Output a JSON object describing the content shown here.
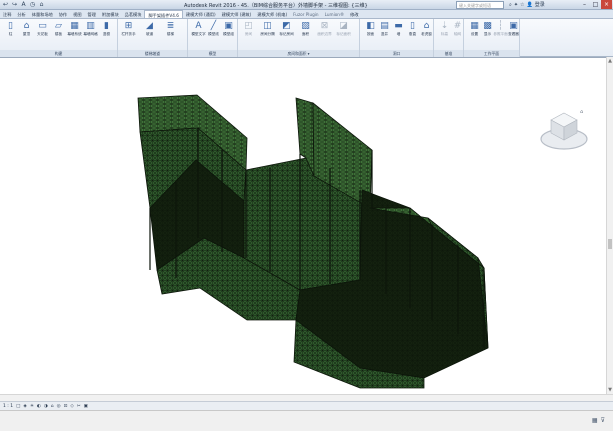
{
  "window": {
    "title": "Autodesk Revit 2016 -     45.（BIM综合服务平台）外墙脚手架 - 三维视图: {三维}",
    "search_placeholder": "键入关键字或短语",
    "login": "登录",
    "quick_access": [
      "↩",
      "↪",
      "A",
      "◷",
      "⌂"
    ]
  },
  "tabs": [
    {
      "label": "注释",
      "active": false
    },
    {
      "label": "分析",
      "active": false
    },
    {
      "label": "体量和场地",
      "active": false
    },
    {
      "label": "协作",
      "active": false
    },
    {
      "label": "视图",
      "active": false
    },
    {
      "label": "管理",
      "active": false
    },
    {
      "label": "附加模块",
      "active": false
    },
    {
      "label": "品茗模块",
      "active": false
    },
    {
      "label": "脚手架插件V4.6",
      "active": true
    },
    {
      "label": "建模大师 (通用)",
      "active": false
    },
    {
      "label": "建模大师 (建筑)",
      "active": false
    },
    {
      "label": "建模大师 (机电)",
      "active": false
    },
    {
      "label": "Fuzor Plugin",
      "active": false
    },
    {
      "label": "Lumion®",
      "active": false
    },
    {
      "label": "修改",
      "active": false
    }
  ],
  "ribbon": {
    "panels": [
      {
        "title": "构建",
        "tools": [
          {
            "label": "柱",
            "icon": "column-icon",
            "glyph": "▯",
            "dim": false
          },
          {
            "label": "屋顶",
            "icon": "roof-icon",
            "glyph": "⌂",
            "dim": false
          },
          {
            "label": "天花板",
            "icon": "ceiling-icon",
            "glyph": "▭",
            "dim": false
          },
          {
            "label": "楼板",
            "icon": "floor-icon",
            "glyph": "▱",
            "dim": false
          },
          {
            "label": "幕墙系统",
            "icon": "curtain-system-icon",
            "glyph": "▦",
            "dim": false
          },
          {
            "label": "幕墙网格",
            "icon": "curtain-grid-icon",
            "glyph": "▥",
            "dim": false
          },
          {
            "label": "竖梃",
            "icon": "mullion-icon",
            "glyph": "▮",
            "dim": false
          }
        ]
      },
      {
        "title": "楼梯坡道",
        "tools": [
          {
            "label": "栏杆扶手",
            "icon": "railing-icon",
            "glyph": "⊞",
            "dim": false
          },
          {
            "label": "坡道",
            "icon": "ramp-icon",
            "glyph": "◢",
            "dim": false
          },
          {
            "label": "楼梯",
            "icon": "stair-icon",
            "glyph": "≣",
            "dim": false
          }
        ]
      },
      {
        "title": "模型",
        "tools": [
          {
            "label": "模型文字",
            "icon": "model-text-icon",
            "glyph": "A",
            "dim": false
          },
          {
            "label": "模型线",
            "icon": "model-line-icon",
            "glyph": "╱",
            "dim": false
          },
          {
            "label": "模型组",
            "icon": "model-group-icon",
            "glyph": "▣",
            "dim": false
          }
        ]
      },
      {
        "title": "房间和面积 ▾",
        "tools": [
          {
            "label": "房间",
            "icon": "room-icon",
            "glyph": "◰",
            "dim": true
          },
          {
            "label": "房间分隔",
            "icon": "room-separator-icon",
            "glyph": "◫",
            "dim": false
          },
          {
            "label": "标记房间",
            "icon": "tag-room-icon",
            "glyph": "◩",
            "dim": false
          },
          {
            "label": "面积",
            "icon": "area-icon",
            "glyph": "▧",
            "dim": false
          },
          {
            "label": "面积边界",
            "icon": "area-boundary-icon",
            "glyph": "⊠",
            "dim": true
          },
          {
            "label": "标记面积",
            "icon": "tag-area-icon",
            "glyph": "◪",
            "dim": true
          }
        ]
      },
      {
        "title": "洞口",
        "tools": [
          {
            "label": "按面",
            "icon": "by-face-icon",
            "glyph": "◧",
            "dim": false
          },
          {
            "label": "竖井",
            "icon": "shaft-icon",
            "glyph": "▤",
            "dim": false
          },
          {
            "label": "墙",
            "icon": "wall-opening-icon",
            "glyph": "▬",
            "dim": false
          },
          {
            "label": "垂直",
            "icon": "vertical-icon",
            "glyph": "▯",
            "dim": false
          },
          {
            "label": "老虎窗",
            "icon": "dormer-icon",
            "glyph": "⌂",
            "dim": false
          }
        ]
      },
      {
        "title": "基准",
        "tools": [
          {
            "label": "标高",
            "icon": "level-icon",
            "glyph": "⇣",
            "dim": true
          },
          {
            "label": "轴网",
            "icon": "grid-icon",
            "glyph": "#",
            "dim": true
          }
        ]
      },
      {
        "title": "工作平面",
        "tools": [
          {
            "label": "设置",
            "icon": "set-workplane-icon",
            "glyph": "▦",
            "dim": false
          },
          {
            "label": "显示",
            "icon": "show-workplane-icon",
            "glyph": "▩",
            "dim": false
          },
          {
            "label": "参照平面",
            "icon": "ref-plane-icon",
            "glyph": "┆",
            "dim": true
          },
          {
            "label": "查看器",
            "icon": "viewer-icon",
            "glyph": "▣",
            "dim": false
          }
        ]
      }
    ]
  },
  "view_controls": {
    "scale": "1 : 1",
    "icons": [
      "□",
      "◈",
      "☀",
      "◐",
      "◑",
      "⌂",
      "◎",
      "⊡",
      "◇",
      "✂",
      "▣"
    ]
  },
  "colors": {
    "scaffold_fill": "#2f5a2c",
    "scaffold_dark": "#14220f",
    "scaffold_light": "#3f7339",
    "mesh_line": "#0c150a"
  }
}
